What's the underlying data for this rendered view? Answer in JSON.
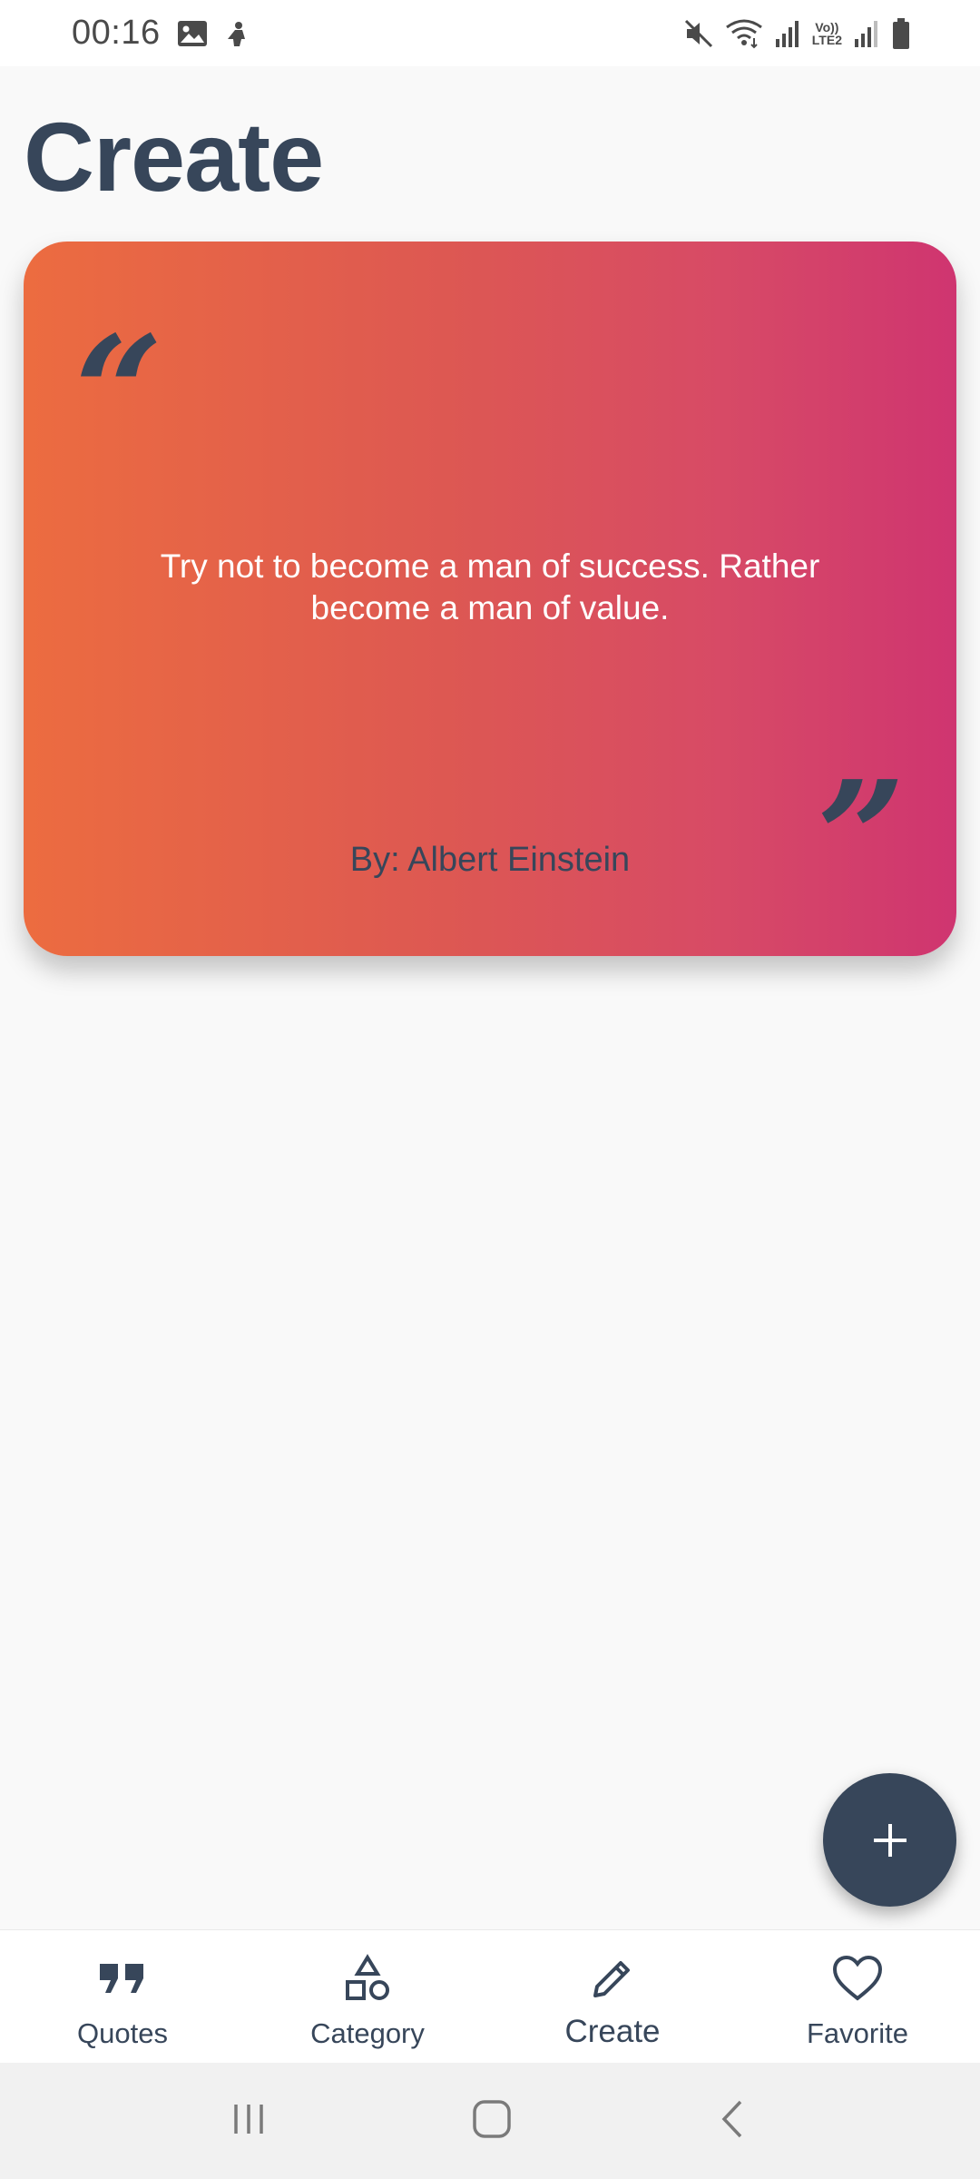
{
  "status_bar": {
    "time": "00:16",
    "left_icons": [
      "image-icon",
      "app-notification-icon"
    ],
    "right_icons": [
      "mute-icon",
      "wifi-icon",
      "signal-icon",
      "volte-icon",
      "signal-icon-2",
      "battery-icon"
    ],
    "volte_text_top": "Vo))",
    "volte_text_bottom": "LTE2"
  },
  "header": {
    "title": "Create"
  },
  "quote_card": {
    "text": "Try not to become a man of success. Rather become a man of value.",
    "author": "By: Albert Einstein",
    "open_mark": "“",
    "close_mark": "”",
    "gradient": [
      "#ec6c40",
      "#cf3570"
    ]
  },
  "fab": {
    "icon": "plus-icon",
    "label": "+"
  },
  "bottom_nav": {
    "items": [
      {
        "label": "Quotes",
        "icon": "quote-icon"
      },
      {
        "label": "Category",
        "icon": "shapes-icon"
      },
      {
        "label": "Create",
        "icon": "pencil-icon",
        "active": true
      },
      {
        "label": "Favorite",
        "icon": "heart-icon"
      }
    ]
  },
  "system_nav": {
    "icons": [
      "recents-icon",
      "home-icon",
      "back-icon"
    ]
  },
  "colors": {
    "primary_dark": "#37465a",
    "background": "#f9f9f9"
  }
}
